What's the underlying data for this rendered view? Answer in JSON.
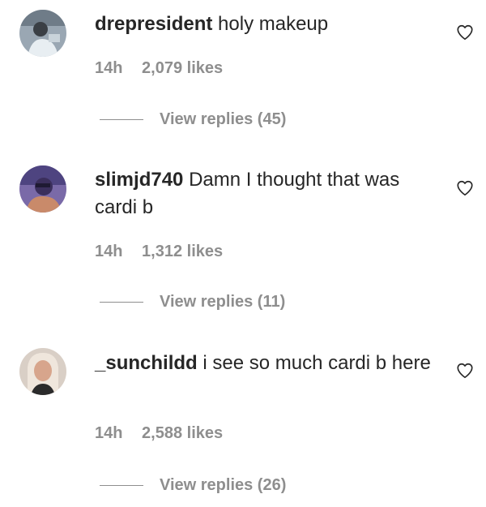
{
  "comments": [
    {
      "username": "drepresident",
      "text": "holy makeup",
      "time": "14h",
      "likes": "2,079 likes",
      "replies": "View replies (45)",
      "like_icon": "heart-outline-icon"
    },
    {
      "username": "slimjd740",
      "text": "Damn I thought that was cardi b",
      "time": "14h",
      "likes": "1,312 likes",
      "replies": "View replies (11)",
      "like_icon": "heart-outline-icon"
    },
    {
      "username": "_sunchildd",
      "text": "i see so much cardi b here",
      "time": "14h",
      "likes": "2,588 likes",
      "replies": "View replies (26)",
      "like_icon": "heart-outline-icon"
    }
  ],
  "colors": {
    "primary_text": "#262626",
    "secondary_text": "#8e8e8e",
    "background": "#ffffff"
  }
}
